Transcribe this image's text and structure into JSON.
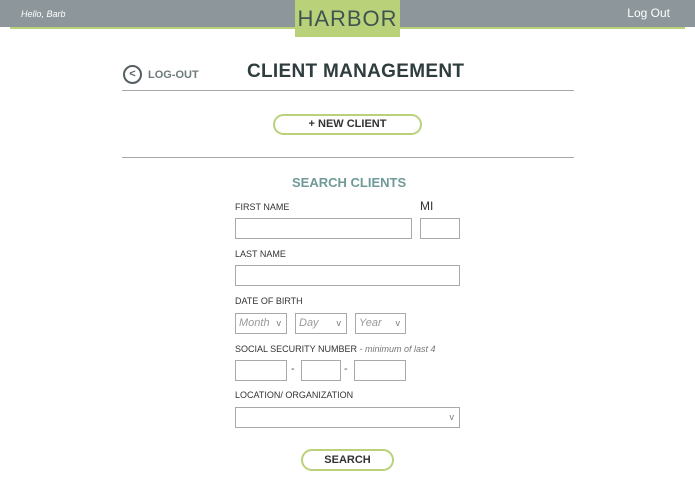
{
  "header": {
    "greeting": "Hello, Barb",
    "logo": "HARBOR",
    "logout": "Log Out"
  },
  "page": {
    "back_icon": "<",
    "back_label": "LOG-OUT",
    "title": "CLIENT MANAGEMENT",
    "new_client_label": "+ NEW CLIENT"
  },
  "search": {
    "title": "SEARCH CLIENTS",
    "first_name_label": "FIRST NAME",
    "mi_label": "MI",
    "last_name_label": "LAST NAME",
    "dob_label": "DATE OF BIRTH",
    "dob_month": "Month",
    "dob_day": "Day",
    "dob_year": "Year",
    "caret": "v",
    "ssn_label": "SOCIAL SECURITY NUMBER",
    "ssn_hint": " - minimum of last 4",
    "ssn_dash": "-",
    "location_label": "LOCATION/ ORGANIZATION",
    "search_button": "SEARCH"
  },
  "colors": {
    "accent": "#b9d27a",
    "header_bg": "#8c969b",
    "section_title": "#6f9a97"
  }
}
